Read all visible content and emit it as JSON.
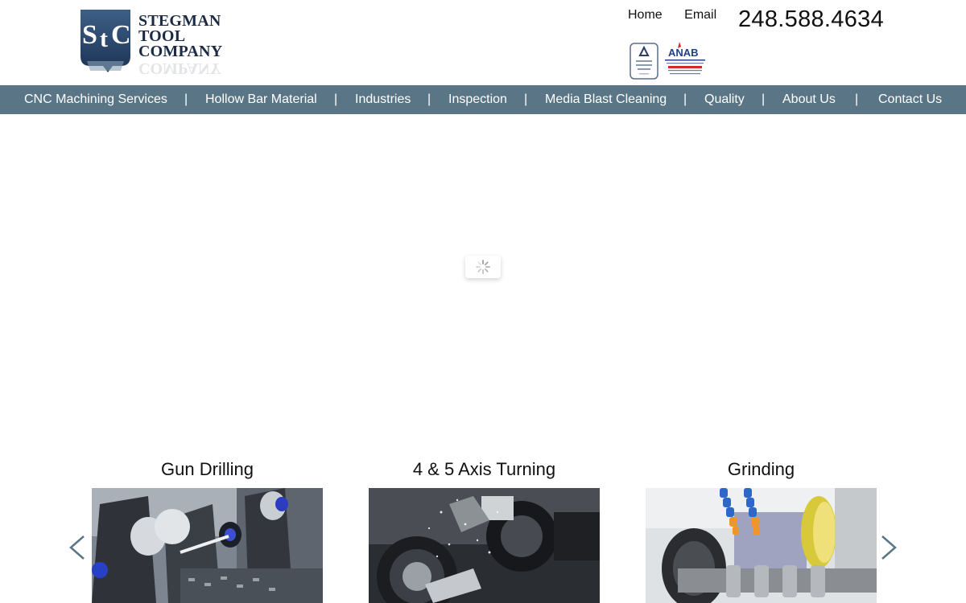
{
  "header": {
    "logo": {
      "line1": "STEGMAN",
      "line2": "TOOL",
      "line3": "COMPANY"
    },
    "top_links": [
      {
        "label": "Home"
      },
      {
        "label": "Email"
      }
    ],
    "phone": "248.588.4634"
  },
  "nav": {
    "items": [
      {
        "label": "CNC Machining Services"
      },
      {
        "label": "Hollow Bar Material"
      },
      {
        "label": "Industries"
      },
      {
        "label": "Inspection"
      },
      {
        "label": "Media Blast Cleaning"
      },
      {
        "label": "Quality"
      },
      {
        "label": "About Us"
      },
      {
        "label": "Contact Us"
      }
    ],
    "separator": "|"
  },
  "services": [
    {
      "title": "Gun Drilling"
    },
    {
      "title": "4 & 5 Axis Turning"
    },
    {
      "title": "Grinding"
    }
  ],
  "colors": {
    "nav_bg": "#5a7686",
    "logo_navy": "#1c2a44",
    "arrow": "#5a7686"
  }
}
